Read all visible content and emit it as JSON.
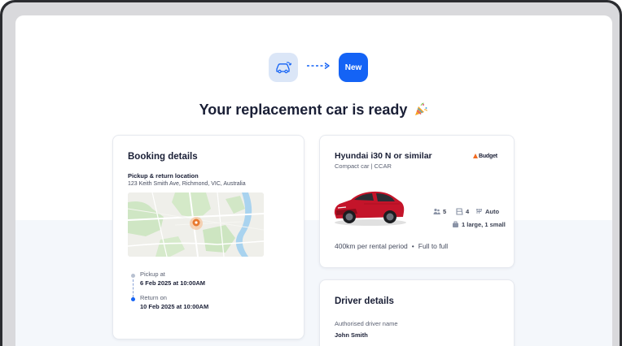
{
  "header": {
    "old_step_icon": "car-swap-icon",
    "new_step_label": "New",
    "title": "Your replacement car is ready",
    "title_emoji_icon": "party-popper-icon"
  },
  "booking": {
    "heading": "Booking details",
    "location_label": "Pickup & return location",
    "location_address": "123 Keith Smith Ave, Richmond, VIC, Australia",
    "pickup_label": "Pickup at",
    "pickup_value": "6 Feb 2025  at 10:00AM",
    "return_label": "Return on",
    "return_value": "10 Feb 2025  at 10:00AM"
  },
  "car": {
    "name": "Hyundai i30 N or similar",
    "class": "Compact car | CCAR",
    "brand": "Budget",
    "seats": "5",
    "doors": "4",
    "transmission": "Auto",
    "luggage": "1 large, 1 small",
    "mileage": "400km per rental period",
    "fuel_policy": "Full to full"
  },
  "driver": {
    "heading": "Driver details",
    "label": "Authorised driver name",
    "name": "John Smith"
  },
  "colors": {
    "accent": "#1463f5",
    "step_old_bg": "#dbe6f7",
    "car_red": "#c4142a",
    "brand_orange": "#f26b21"
  }
}
